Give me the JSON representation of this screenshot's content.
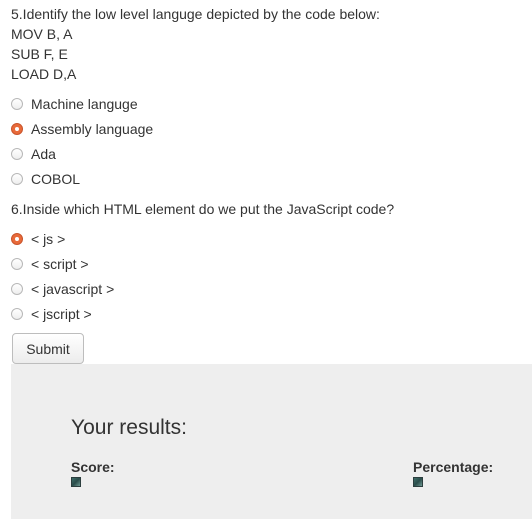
{
  "question5": {
    "text": "5.Identify the low level languge depicted by the code below:",
    "code_lines": [
      "MOV B, A",
      "SUB F, E",
      "LOAD D,A"
    ],
    "options": [
      {
        "label": "Machine languge",
        "checked": false
      },
      {
        "label": "Assembly language",
        "checked": true
      },
      {
        "label": "Ada",
        "checked": false
      },
      {
        "label": "COBOL",
        "checked": false
      }
    ]
  },
  "question6": {
    "text": "6.Inside which HTML element do we put the JavaScript code?",
    "options": [
      {
        "label": "< js >",
        "checked": true
      },
      {
        "label": "< script >",
        "checked": false
      },
      {
        "label": "< javascript >",
        "checked": false
      },
      {
        "label": "< jscript >",
        "checked": false
      }
    ]
  },
  "submit_label": "Submit",
  "results": {
    "title": "Your results:",
    "score_label": "Score:",
    "percentage_label": "Percentage:"
  },
  "colors": {
    "accent": "#e86a3a",
    "panel_bg": "#eeeeee",
    "text": "#333333"
  }
}
